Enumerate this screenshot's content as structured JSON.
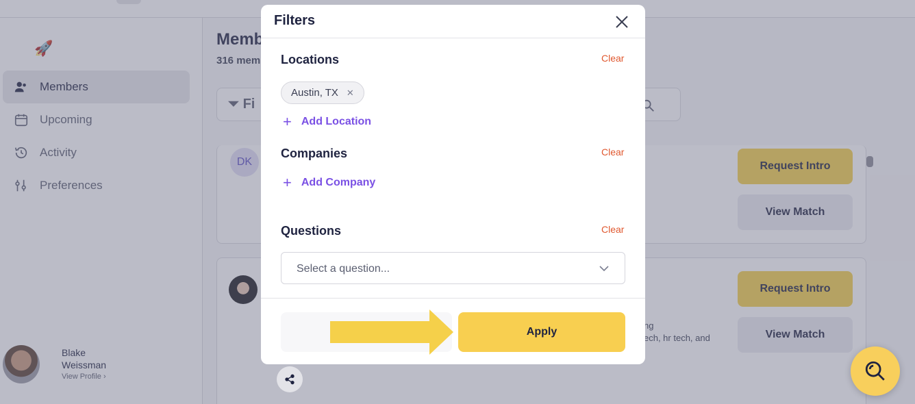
{
  "app": {
    "page_title": "Memb",
    "member_count_text": "316 mem",
    "filter_bar_text": "Fi",
    "nav": [
      {
        "label": "Members",
        "icon": "members-icon",
        "active": true
      },
      {
        "label": "Upcoming",
        "icon": "calendar-icon",
        "active": false
      },
      {
        "label": "Activity",
        "icon": "history-icon",
        "active": false
      },
      {
        "label": "Preferences",
        "icon": "sliders-icon",
        "active": false
      }
    ],
    "logo_icon": "rocket-icon",
    "profile": {
      "name": "Blake Weissman",
      "link": "View Profile"
    },
    "cards": [
      {
        "initials": "DK",
        "request_label": "Request Intro",
        "view_label": "View Match"
      },
      {
        "request_label": "Request Intro",
        "view_label": "View Match",
        "snippet_line1": "ng",
        "snippet_line2": "ech, hr tech, and"
      }
    ]
  },
  "modal": {
    "title": "Filters",
    "close_icon": "close-icon",
    "sections": {
      "locations": {
        "title": "Locations",
        "clear_label": "Clear",
        "chips": [
          "Austin, TX"
        ],
        "add_label": "Add Location"
      },
      "companies": {
        "title": "Companies",
        "clear_label": "Clear",
        "add_label": "Add Company"
      },
      "questions": {
        "title": "Questions",
        "clear_label": "Clear",
        "placeholder": "Select a question..."
      }
    },
    "apply_label": "Apply"
  },
  "colors": {
    "accent_yellow": "#f8cf50",
    "clear_red": "#e0582f",
    "link_purple": "#7a50e4",
    "arrow_yellow": "#f5d04a"
  }
}
